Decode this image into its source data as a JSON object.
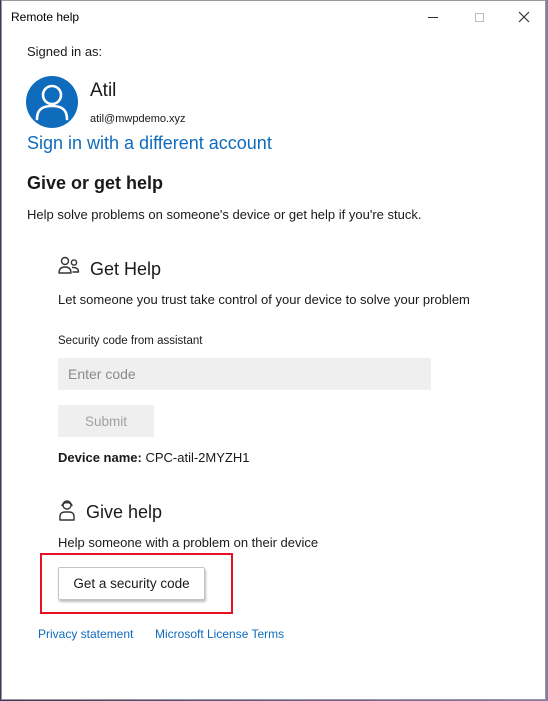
{
  "window": {
    "title": "Remote help",
    "colors": {
      "accent": "#0f6cbd",
      "highlight": "#e81123"
    }
  },
  "account": {
    "signed_in_label": "Signed in as:",
    "name": "Atil",
    "email": "atil@mwpdemo.xyz",
    "switch_link": "Sign in with a different account"
  },
  "intro": {
    "heading": "Give or get help",
    "description": "Help solve problems on someone's device or get help if you're stuck."
  },
  "get_help": {
    "title": "Get Help",
    "description": "Let someone you trust take control of your device to solve your problem",
    "code_label": "Security code from assistant",
    "code_placeholder": "Enter code",
    "code_value": "",
    "submit_label": "Submit",
    "device_label": "Device name:",
    "device_name": "CPC-atil-2MYZH1"
  },
  "give_help": {
    "title": "Give help",
    "description": "Help someone with a problem on their device",
    "button_label": "Get a security code"
  },
  "footer": {
    "privacy": "Privacy statement",
    "license": "Microsoft License Terms"
  },
  "icons": {
    "avatar": "person-icon",
    "get_help": "people-icon",
    "give_help": "person-support-icon",
    "minimize": "minimize-icon",
    "maximize": "maximize-icon",
    "close": "close-icon"
  }
}
